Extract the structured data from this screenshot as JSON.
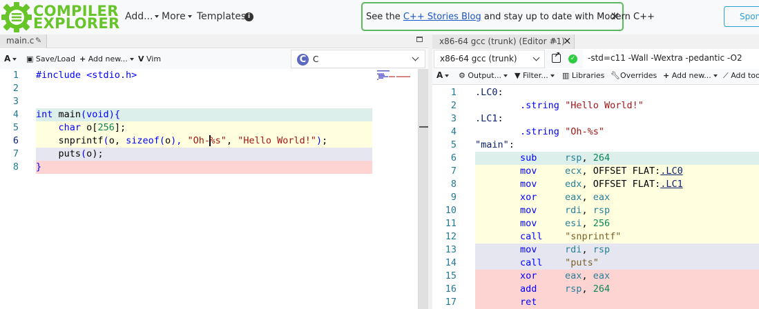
{
  "nav": {
    "brand_line1": "COMPILER",
    "brand_line2": "EXPLORER",
    "add_label": "Add...",
    "more_label": "More",
    "templates_label": "Templates",
    "info_glyph": "i",
    "news_prefix": "See the ",
    "news_link": "C++ Stories Blog",
    "news_suffix": " and stay up to date with Modern C++",
    "news_close": "×",
    "sponsor_label": "Sponsors"
  },
  "editor": {
    "tab_label": "main.c",
    "toolbar": {
      "font_label": "A",
      "save_label": "Save/Load",
      "add_new_label": "Add new...",
      "vim_label": "Vim"
    },
    "language": "C",
    "language_glyph": "C",
    "line_numbers": [
      "1",
      "2",
      "3",
      "4",
      "5",
      "6",
      "7",
      "8"
    ],
    "current_line": 6,
    "lines": [
      {
        "bg": "#ffffff",
        "tokens": [
          {
            "t": "#include <stdio.h>",
            "c": "pp"
          }
        ]
      },
      {
        "bg": "#ffffff",
        "tokens": []
      },
      {
        "bg": "#ffffff",
        "tokens": []
      },
      {
        "bg": "#ddefeb",
        "tokens": [
          {
            "t": "int",
            "c": "kt"
          },
          {
            "t": " main",
            "c": "plain"
          },
          {
            "t": "(",
            "c": "kw"
          },
          {
            "t": "void",
            "c": "kt"
          },
          {
            "t": "){",
            "c": "kw"
          }
        ]
      },
      {
        "bg": "#ffffdf",
        "tokens": [
          {
            "t": "    char",
            "c": "kt"
          },
          {
            "t": " o",
            "c": "plain"
          },
          {
            "t": "[",
            "c": "plain"
          },
          {
            "t": "256",
            "c": "num"
          },
          {
            "t": "];",
            "c": "plain"
          }
        ]
      },
      {
        "bg": "#ffffdf",
        "tokens": [
          {
            "t": "    snprintf",
            "c": "plain"
          },
          {
            "t": "(",
            "c": "kw"
          },
          {
            "t": "o, ",
            "c": "plain"
          },
          {
            "t": "sizeof",
            "c": "kw"
          },
          {
            "t": "(",
            "c": "kw"
          },
          {
            "t": "o",
            "c": "plain"
          },
          {
            "t": "), ",
            "c": "kw"
          },
          {
            "t": "\"Oh-",
            "c": "str"
          },
          {
            "t": "",
            "c": "cursor"
          },
          {
            "t": "%s\"",
            "c": "str"
          },
          {
            "t": ", ",
            "c": "plain"
          },
          {
            "t": "\"Hello World!\"",
            "c": "str"
          },
          {
            "t": ")",
            "c": "kw"
          },
          {
            "t": ";",
            "c": "plain"
          }
        ]
      },
      {
        "bg": "#e6e6f0",
        "tokens": [
          {
            "t": "    puts",
            "c": "plain"
          },
          {
            "t": "(",
            "c": "kw"
          },
          {
            "t": "o",
            "c": "plain"
          },
          {
            "t": ");",
            "c": "plain"
          }
        ]
      },
      {
        "bg": "#fdd4d2",
        "tokens": [
          {
            "t": "}",
            "c": "kw"
          }
        ]
      }
    ]
  },
  "compiler": {
    "tab_label": "x86-64 gcc (trunk) (Editor #1)",
    "close_glyph": "×",
    "selected_compiler": "x86-64 gcc (trunk)",
    "status_glyph": "✓",
    "flags": "-std=c11 -Wall -Wextra -pedantic -O2",
    "toolbar": {
      "font_label": "A",
      "output_label": "Output...",
      "filter_label": "Filter...",
      "libraries_label": "Libraries",
      "overrides_label": "Overrides",
      "add_new_label": "Add new...",
      "add_tool_label": "Add tool..."
    },
    "line_numbers": [
      "1",
      "2",
      "3",
      "4",
      "5",
      "6",
      "7",
      "8",
      "9",
      "10",
      "11",
      "12",
      "13",
      "14",
      "15",
      "16",
      "17"
    ],
    "lines": [
      {
        "bg": "#ffffff",
        "tokens": [
          {
            "t": ".LC0",
            "c": "lbl"
          },
          {
            "t": ":",
            "c": "plain"
          }
        ]
      },
      {
        "bg": "#ffffff",
        "tokens": [
          {
            "t": "        .string",
            "c": "ins"
          },
          {
            "t": " ",
            "c": "plain"
          },
          {
            "t": "\"Hello World!\"",
            "c": "str"
          }
        ]
      },
      {
        "bg": "#ffffff",
        "tokens": [
          {
            "t": ".LC1",
            "c": "lbl"
          },
          {
            "t": ":",
            "c": "plain"
          }
        ]
      },
      {
        "bg": "#ffffff",
        "tokens": [
          {
            "t": "        .string",
            "c": "ins"
          },
          {
            "t": " ",
            "c": "plain"
          },
          {
            "t": "\"Oh-%s\"",
            "c": "str"
          }
        ]
      },
      {
        "bg": "#ffffff",
        "tokens": [
          {
            "t": "\"main\"",
            "c": "lbl"
          },
          {
            "t": ":",
            "c": "plain"
          }
        ]
      },
      {
        "bg": "#ddefeb",
        "tokens": [
          {
            "t": "        sub",
            "c": "ins"
          },
          {
            "t": "     ",
            "c": "plain"
          },
          {
            "t": "rsp",
            "c": "reg"
          },
          {
            "t": ", ",
            "c": "plain"
          },
          {
            "t": "264",
            "c": "num"
          }
        ]
      },
      {
        "bg": "#ffffdf",
        "tokens": [
          {
            "t": "        mov",
            "c": "ins"
          },
          {
            "t": "     ",
            "c": "plain"
          },
          {
            "t": "ecx",
            "c": "reg"
          },
          {
            "t": ", OFFSET FLAT:",
            "c": "plain"
          },
          {
            "t": ".LC0",
            "c": "ul"
          }
        ]
      },
      {
        "bg": "#ffffdf",
        "tokens": [
          {
            "t": "        mov",
            "c": "ins"
          },
          {
            "t": "     ",
            "c": "plain"
          },
          {
            "t": "edx",
            "c": "reg"
          },
          {
            "t": ", OFFSET FLAT:",
            "c": "plain"
          },
          {
            "t": ".LC1",
            "c": "ul"
          }
        ]
      },
      {
        "bg": "#ffffdf",
        "tokens": [
          {
            "t": "        xor",
            "c": "ins"
          },
          {
            "t": "     ",
            "c": "plain"
          },
          {
            "t": "eax",
            "c": "reg"
          },
          {
            "t": ", ",
            "c": "plain"
          },
          {
            "t": "eax",
            "c": "reg"
          }
        ]
      },
      {
        "bg": "#ffffdf",
        "tokens": [
          {
            "t": "        mov",
            "c": "ins"
          },
          {
            "t": "     ",
            "c": "plain"
          },
          {
            "t": "rdi",
            "c": "reg"
          },
          {
            "t": ", ",
            "c": "plain"
          },
          {
            "t": "rsp",
            "c": "reg"
          }
        ]
      },
      {
        "bg": "#ffffdf",
        "tokens": [
          {
            "t": "        mov",
            "c": "ins"
          },
          {
            "t": "     ",
            "c": "plain"
          },
          {
            "t": "esi",
            "c": "reg"
          },
          {
            "t": ", ",
            "c": "plain"
          },
          {
            "t": "256",
            "c": "num"
          }
        ]
      },
      {
        "bg": "#ffffdf",
        "tokens": [
          {
            "t": "        call",
            "c": "ins"
          },
          {
            "t": "    ",
            "c": "plain"
          },
          {
            "t": "\"snprintf\"",
            "c": "fn"
          }
        ]
      },
      {
        "bg": "#e6e6f0",
        "tokens": [
          {
            "t": "        mov",
            "c": "ins"
          },
          {
            "t": "     ",
            "c": "plain"
          },
          {
            "t": "rdi",
            "c": "reg"
          },
          {
            "t": ", ",
            "c": "plain"
          },
          {
            "t": "rsp",
            "c": "reg"
          }
        ]
      },
      {
        "bg": "#e6e6f0",
        "tokens": [
          {
            "t": "        call",
            "c": "ins"
          },
          {
            "t": "    ",
            "c": "plain"
          },
          {
            "t": "\"puts\"",
            "c": "fn"
          }
        ]
      },
      {
        "bg": "#fdd4d2",
        "tokens": [
          {
            "t": "        xor",
            "c": "ins"
          },
          {
            "t": "     ",
            "c": "plain"
          },
          {
            "t": "eax",
            "c": "reg"
          },
          {
            "t": ", ",
            "c": "plain"
          },
          {
            "t": "eax",
            "c": "reg"
          }
        ]
      },
      {
        "bg": "#fdd4d2",
        "tokens": [
          {
            "t": "        add",
            "c": "ins"
          },
          {
            "t": "     ",
            "c": "plain"
          },
          {
            "t": "rsp",
            "c": "reg"
          },
          {
            "t": ", ",
            "c": "plain"
          },
          {
            "t": "264",
            "c": "num"
          }
        ]
      },
      {
        "bg": "#fdd4d2",
        "tokens": [
          {
            "t": "        ret",
            "c": "ins"
          }
        ]
      }
    ]
  },
  "colors": {
    "brand_green": "#67c52a",
    "news_border": "#5cb85c",
    "link_blue": "#1a55c8",
    "sponsor_blue": "#2a9fd6"
  }
}
